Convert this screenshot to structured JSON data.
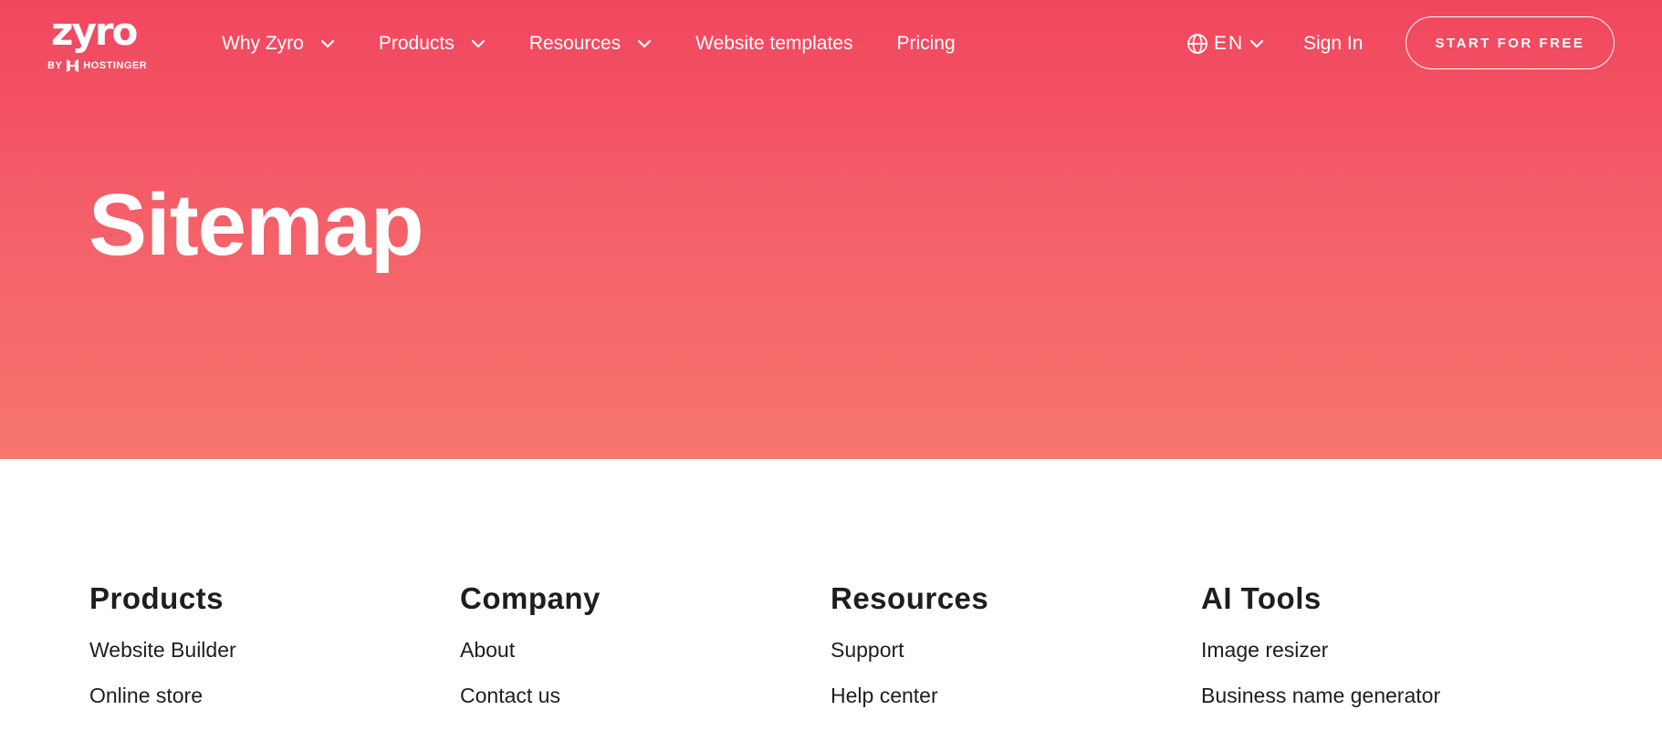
{
  "header": {
    "logo": {
      "word": "zyro",
      "by": "BY",
      "brand": "HOSTINGER"
    },
    "nav": [
      {
        "label": "Why Zyro",
        "has_dropdown": true
      },
      {
        "label": "Products",
        "has_dropdown": true
      },
      {
        "label": "Resources",
        "has_dropdown": true
      },
      {
        "label": "Website templates",
        "has_dropdown": false
      },
      {
        "label": "Pricing",
        "has_dropdown": false
      }
    ],
    "language": {
      "code": "EN",
      "icon": "globe-icon"
    },
    "sign_in": "Sign In",
    "cta": "START FOR FREE"
  },
  "hero": {
    "title": "Sitemap",
    "gradient": [
      "#f2465f",
      "#f7766e"
    ]
  },
  "sitemap": {
    "columns": [
      {
        "heading": "Products",
        "links": [
          "Website Builder",
          "Online store"
        ]
      },
      {
        "heading": "Company",
        "links": [
          "About",
          "Contact us"
        ]
      },
      {
        "heading": "Resources",
        "links": [
          "Support",
          "Help center"
        ]
      },
      {
        "heading": "AI Tools",
        "links": [
          "Image resizer",
          "Business name generator"
        ]
      }
    ]
  },
  "colors": {
    "text_dark": "#1d1e20",
    "on_hero": "#ffffff"
  }
}
